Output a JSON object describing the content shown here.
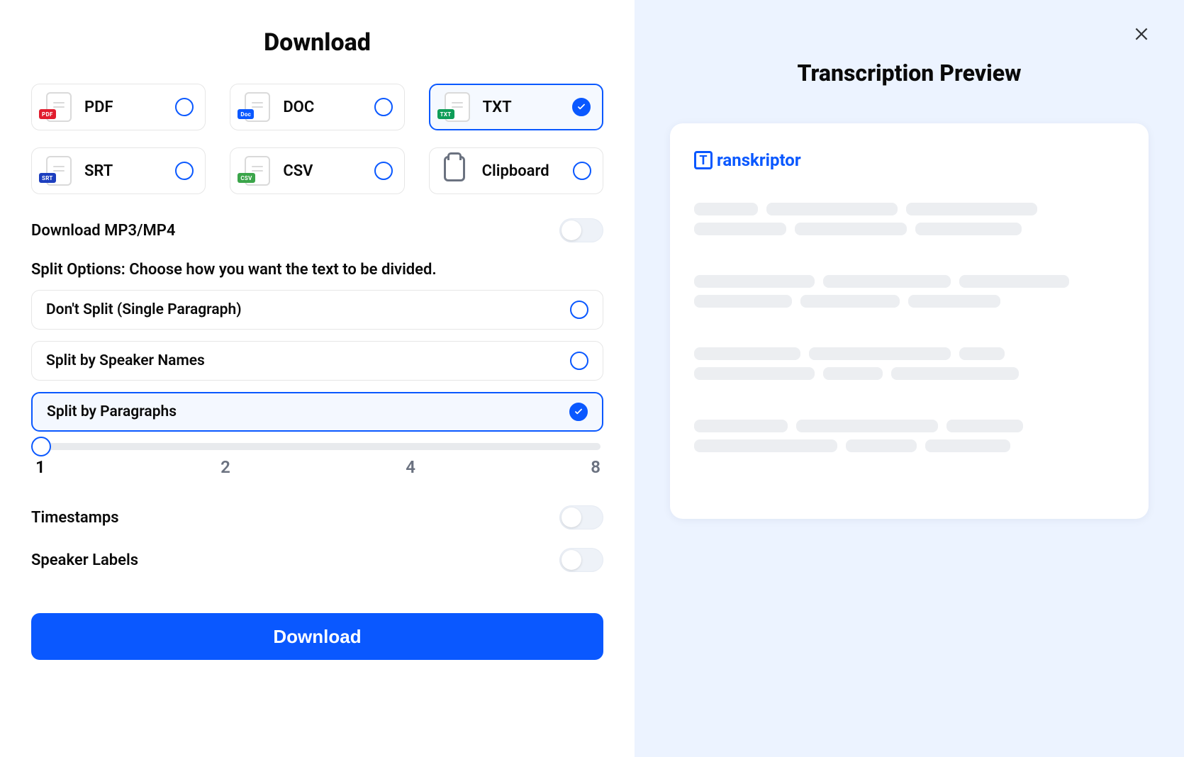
{
  "left": {
    "title": "Download",
    "formats": [
      {
        "key": "pdf",
        "label": "PDF",
        "badge": "PDF",
        "badgeClass": "pdf",
        "selected": false
      },
      {
        "key": "doc",
        "label": "DOC",
        "badge": "Doc",
        "badgeClass": "doc",
        "selected": false
      },
      {
        "key": "txt",
        "label": "TXT",
        "badge": "TXT",
        "badgeClass": "txt",
        "selected": true
      },
      {
        "key": "srt",
        "label": "SRT",
        "badge": "SRT",
        "badgeClass": "srt",
        "selected": false
      },
      {
        "key": "csv",
        "label": "CSV",
        "badge": "CSV",
        "badgeClass": "csv",
        "selected": false
      },
      {
        "key": "clipboard",
        "label": "Clipboard",
        "selected": false,
        "clipboard": true
      }
    ],
    "mp3_label": "Download MP3/MP4",
    "mp3_on": false,
    "split_header": "Split Options: Choose how you want the text to be divided.",
    "split_options": [
      {
        "label": "Don't Split (Single Paragraph)",
        "selected": false
      },
      {
        "label": "Split by Speaker Names",
        "selected": false
      },
      {
        "label": "Split by Paragraphs",
        "selected": true
      }
    ],
    "slider": {
      "value": 1,
      "labels": [
        "1",
        "2",
        "4",
        "8"
      ]
    },
    "timestamps_label": "Timestamps",
    "timestamps_on": false,
    "speaker_label": "Speaker Labels",
    "speaker_on": false,
    "download_btn": "Download"
  },
  "right": {
    "title": "Transcription Preview",
    "brand": "ranskriptor",
    "brand_initial": "T",
    "paragraphs": [
      {
        "rows": [
          [
            90,
            185,
            185
          ],
          [
            130,
            158,
            150
          ]
        ]
      },
      {
        "rows": [
          [
            170,
            180,
            155
          ],
          [
            138,
            140,
            130
          ]
        ]
      },
      {
        "rows": [
          [
            150,
            200,
            64
          ],
          [
            170,
            84,
            180
          ]
        ]
      },
      {
        "rows": [
          [
            132,
            200,
            108
          ],
          [
            202,
            100,
            120
          ]
        ]
      }
    ]
  }
}
